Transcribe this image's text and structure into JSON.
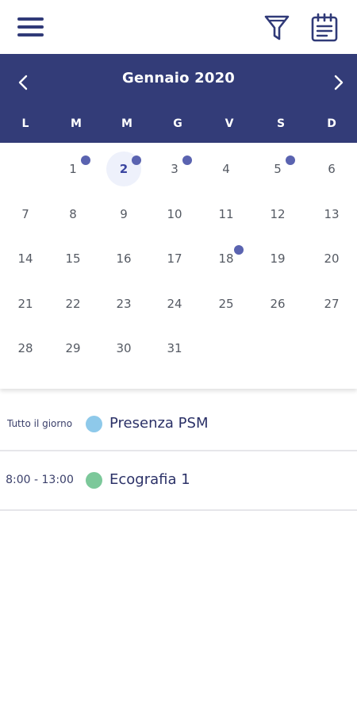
{
  "calendar": {
    "month_label": "Gennaio 2020",
    "weekdays": [
      "L",
      "M",
      "M",
      "G",
      "V",
      "S",
      "D"
    ],
    "days": [
      "1",
      "2",
      "3",
      "4",
      "5",
      "6",
      "7",
      "8",
      "9",
      "10",
      "11",
      "12",
      "13",
      "14",
      "15",
      "16",
      "17",
      "18",
      "19",
      "20",
      "21",
      "22",
      "23",
      "24",
      "25",
      "26",
      "27",
      "28",
      "29",
      "30",
      "31"
    ],
    "selected_day": "2",
    "days_with_events": [
      "1",
      "2",
      "3",
      "5",
      "18"
    ]
  },
  "events": [
    {
      "time": "Tutto il giorno",
      "title": "Presenza PSM",
      "color": "#8ec9ea"
    },
    {
      "time": "8:00 - 13:00",
      "title": "Ecografia 1",
      "color": "#7cc89a"
    }
  ],
  "colors": {
    "header_bg": "#333c78",
    "accent_dot": "#5a63b0"
  },
  "icons": {
    "menu": "hamburger-menu-icon",
    "filter": "filter-funnel-icon",
    "notes": "notepad-list-icon",
    "prev": "chevron-left-icon",
    "next": "chevron-right-icon"
  }
}
